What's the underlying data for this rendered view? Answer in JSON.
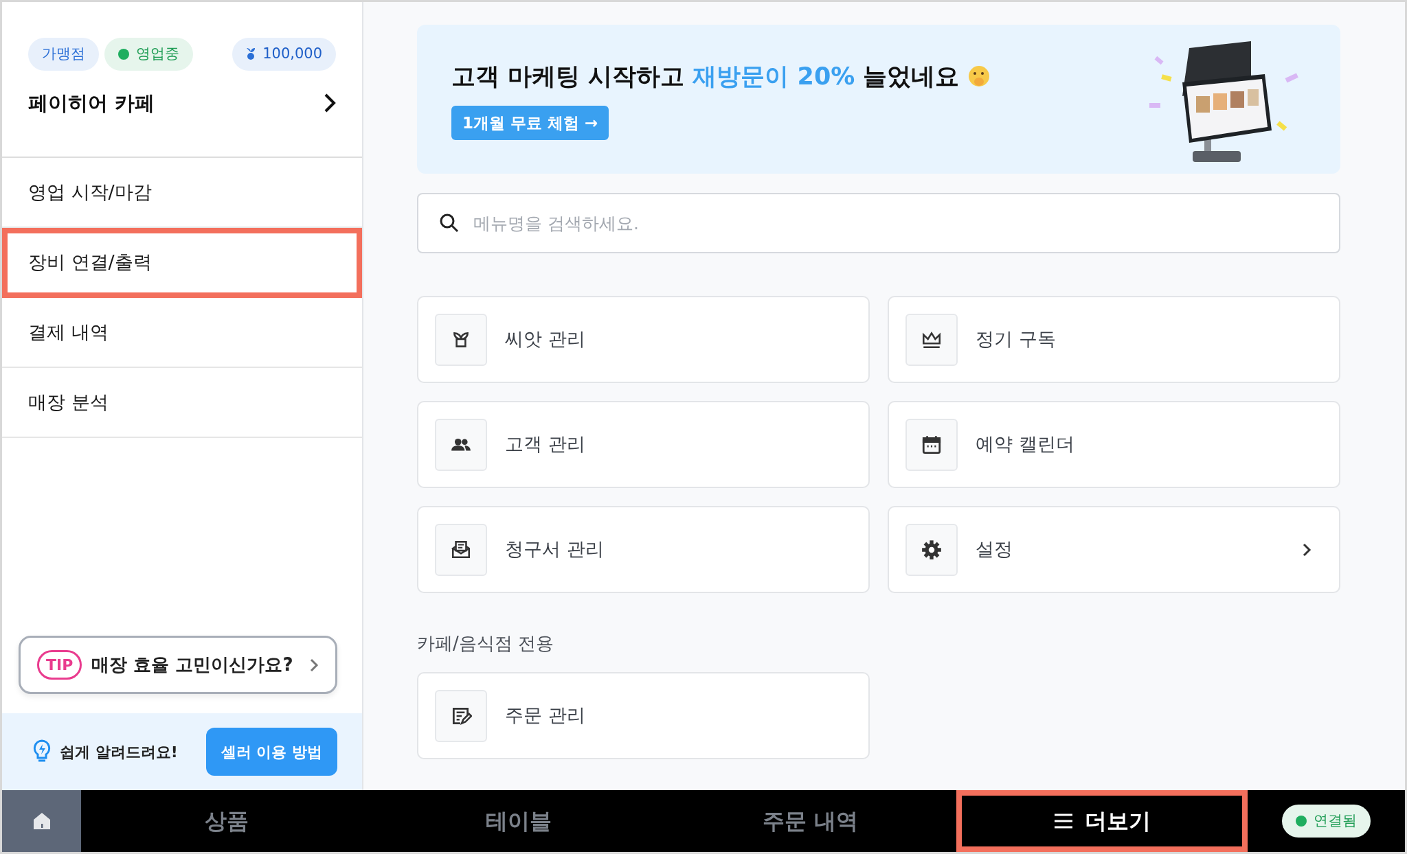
{
  "sidebar": {
    "badges": [
      {
        "kind": "type",
        "label": "가맹점"
      },
      {
        "kind": "status",
        "label": "영업중"
      },
      {
        "kind": "points",
        "label": "100,000"
      }
    ],
    "store_name": "페이히어 카페",
    "items": [
      {
        "label": "영업 시작/마감",
        "highlighted": false
      },
      {
        "label": "장비 연결/출력",
        "highlighted": true
      },
      {
        "label": "결제 내역",
        "highlighted": false
      },
      {
        "label": "매장 분석",
        "highlighted": false
      }
    ],
    "tip": {
      "tag": "TIP",
      "text": "매장 효율 고민이신가요?"
    },
    "help": {
      "text": "쉽게 알려드려요!",
      "button": "셀러 이용 방법"
    }
  },
  "banner": {
    "title_parts": [
      {
        "text": "고객 마케팅 시작하고",
        "accent": false
      },
      {
        "text": "재방문이 20%",
        "accent": true
      },
      {
        "text": "늘었네요",
        "accent": false
      }
    ],
    "button": "1개월 무료 체험 →"
  },
  "search": {
    "placeholder": "메뉴명을 검색하세요."
  },
  "menu": [
    {
      "label": "씨앗 관리",
      "arrow": false
    },
    {
      "label": "정기 구독",
      "arrow": false
    },
    {
      "label": "고객 관리",
      "arrow": false
    },
    {
      "label": "예약 캘린더",
      "arrow": false
    },
    {
      "label": "청구서 관리",
      "arrow": false
    },
    {
      "label": "설정",
      "arrow": true
    }
  ],
  "section": {
    "title": "카페/음식점 전용",
    "items": [
      {
        "label": "주문 관리",
        "arrow": false
      }
    ]
  },
  "bottom_bar": {
    "tabs": [
      {
        "kind": "home",
        "selected": false,
        "highlighted": false
      },
      {
        "kind": "text",
        "label": "상품",
        "selected": false,
        "highlighted": false
      },
      {
        "kind": "text",
        "label": "테이블",
        "selected": false,
        "highlighted": false
      },
      {
        "kind": "text",
        "label": "주문 내역",
        "selected": false,
        "highlighted": false
      },
      {
        "kind": "menu",
        "label": "더보기",
        "selected": true,
        "highlighted": true
      }
    ],
    "connection": {
      "label": "연결됨",
      "connected": true
    }
  }
}
